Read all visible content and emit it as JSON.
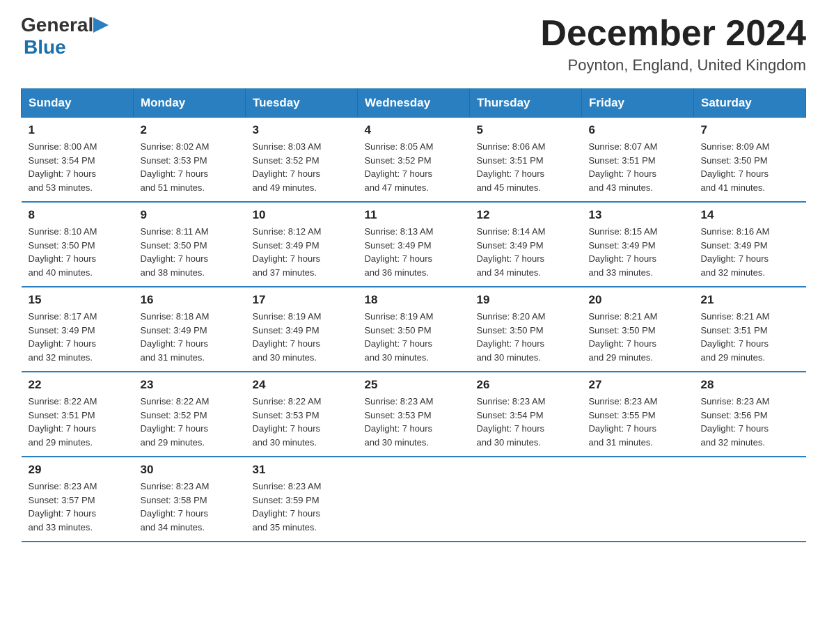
{
  "header": {
    "logo_general": "General",
    "logo_blue": "Blue",
    "month_title": "December 2024",
    "location": "Poynton, England, United Kingdom"
  },
  "days_of_week": [
    "Sunday",
    "Monday",
    "Tuesday",
    "Wednesday",
    "Thursday",
    "Friday",
    "Saturday"
  ],
  "weeks": [
    [
      {
        "day": "1",
        "sunrise": "8:00 AM",
        "sunset": "3:54 PM",
        "daylight": "7 hours and 53 minutes."
      },
      {
        "day": "2",
        "sunrise": "8:02 AM",
        "sunset": "3:53 PM",
        "daylight": "7 hours and 51 minutes."
      },
      {
        "day": "3",
        "sunrise": "8:03 AM",
        "sunset": "3:52 PM",
        "daylight": "7 hours and 49 minutes."
      },
      {
        "day": "4",
        "sunrise": "8:05 AM",
        "sunset": "3:52 PM",
        "daylight": "7 hours and 47 minutes."
      },
      {
        "day": "5",
        "sunrise": "8:06 AM",
        "sunset": "3:51 PM",
        "daylight": "7 hours and 45 minutes."
      },
      {
        "day": "6",
        "sunrise": "8:07 AM",
        "sunset": "3:51 PM",
        "daylight": "7 hours and 43 minutes."
      },
      {
        "day": "7",
        "sunrise": "8:09 AM",
        "sunset": "3:50 PM",
        "daylight": "7 hours and 41 minutes."
      }
    ],
    [
      {
        "day": "8",
        "sunrise": "8:10 AM",
        "sunset": "3:50 PM",
        "daylight": "7 hours and 40 minutes."
      },
      {
        "day": "9",
        "sunrise": "8:11 AM",
        "sunset": "3:50 PM",
        "daylight": "7 hours and 38 minutes."
      },
      {
        "day": "10",
        "sunrise": "8:12 AM",
        "sunset": "3:49 PM",
        "daylight": "7 hours and 37 minutes."
      },
      {
        "day": "11",
        "sunrise": "8:13 AM",
        "sunset": "3:49 PM",
        "daylight": "7 hours and 36 minutes."
      },
      {
        "day": "12",
        "sunrise": "8:14 AM",
        "sunset": "3:49 PM",
        "daylight": "7 hours and 34 minutes."
      },
      {
        "day": "13",
        "sunrise": "8:15 AM",
        "sunset": "3:49 PM",
        "daylight": "7 hours and 33 minutes."
      },
      {
        "day": "14",
        "sunrise": "8:16 AM",
        "sunset": "3:49 PM",
        "daylight": "7 hours and 32 minutes."
      }
    ],
    [
      {
        "day": "15",
        "sunrise": "8:17 AM",
        "sunset": "3:49 PM",
        "daylight": "7 hours and 32 minutes."
      },
      {
        "day": "16",
        "sunrise": "8:18 AM",
        "sunset": "3:49 PM",
        "daylight": "7 hours and 31 minutes."
      },
      {
        "day": "17",
        "sunrise": "8:19 AM",
        "sunset": "3:49 PM",
        "daylight": "7 hours and 30 minutes."
      },
      {
        "day": "18",
        "sunrise": "8:19 AM",
        "sunset": "3:50 PM",
        "daylight": "7 hours and 30 minutes."
      },
      {
        "day": "19",
        "sunrise": "8:20 AM",
        "sunset": "3:50 PM",
        "daylight": "7 hours and 30 minutes."
      },
      {
        "day": "20",
        "sunrise": "8:21 AM",
        "sunset": "3:50 PM",
        "daylight": "7 hours and 29 minutes."
      },
      {
        "day": "21",
        "sunrise": "8:21 AM",
        "sunset": "3:51 PM",
        "daylight": "7 hours and 29 minutes."
      }
    ],
    [
      {
        "day": "22",
        "sunrise": "8:22 AM",
        "sunset": "3:51 PM",
        "daylight": "7 hours and 29 minutes."
      },
      {
        "day": "23",
        "sunrise": "8:22 AM",
        "sunset": "3:52 PM",
        "daylight": "7 hours and 29 minutes."
      },
      {
        "day": "24",
        "sunrise": "8:22 AM",
        "sunset": "3:53 PM",
        "daylight": "7 hours and 30 minutes."
      },
      {
        "day": "25",
        "sunrise": "8:23 AM",
        "sunset": "3:53 PM",
        "daylight": "7 hours and 30 minutes."
      },
      {
        "day": "26",
        "sunrise": "8:23 AM",
        "sunset": "3:54 PM",
        "daylight": "7 hours and 30 minutes."
      },
      {
        "day": "27",
        "sunrise": "8:23 AM",
        "sunset": "3:55 PM",
        "daylight": "7 hours and 31 minutes."
      },
      {
        "day": "28",
        "sunrise": "8:23 AM",
        "sunset": "3:56 PM",
        "daylight": "7 hours and 32 minutes."
      }
    ],
    [
      {
        "day": "29",
        "sunrise": "8:23 AM",
        "sunset": "3:57 PM",
        "daylight": "7 hours and 33 minutes."
      },
      {
        "day": "30",
        "sunrise": "8:23 AM",
        "sunset": "3:58 PM",
        "daylight": "7 hours and 34 minutes."
      },
      {
        "day": "31",
        "sunrise": "8:23 AM",
        "sunset": "3:59 PM",
        "daylight": "7 hours and 35 minutes."
      },
      null,
      null,
      null,
      null
    ]
  ],
  "labels": {
    "sunrise": "Sunrise:",
    "sunset": "Sunset:",
    "daylight": "Daylight:"
  }
}
